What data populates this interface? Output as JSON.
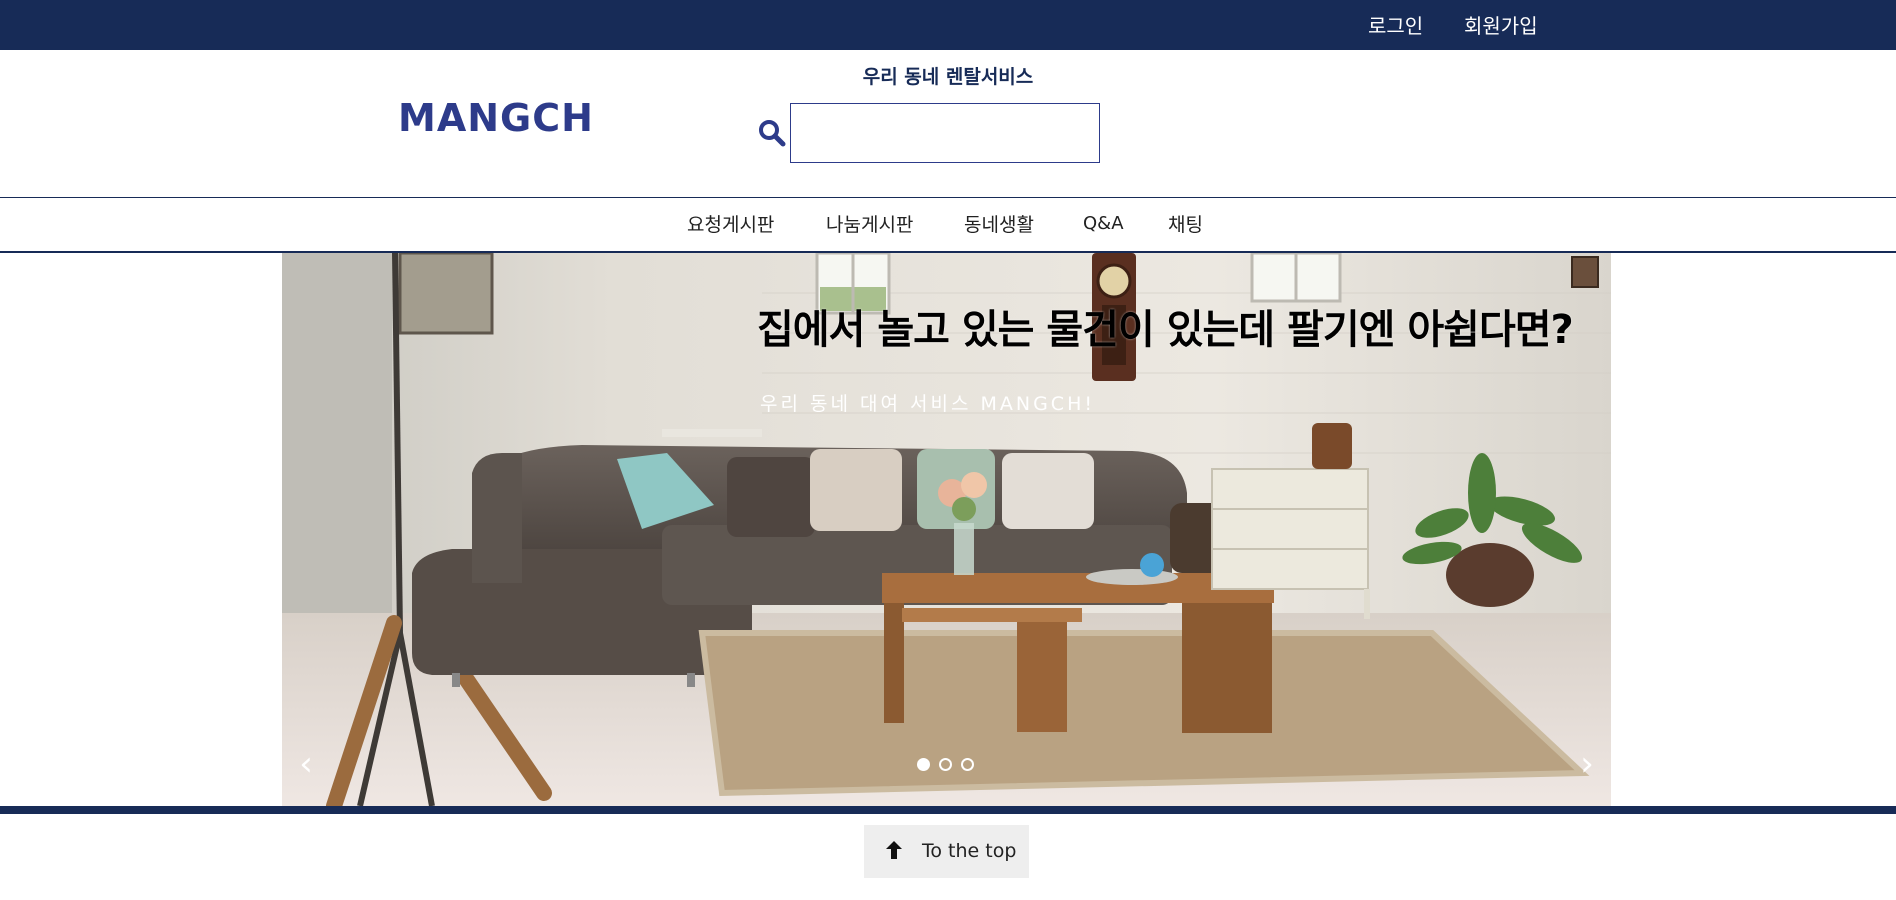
{
  "topbar": {
    "login": "로그인",
    "signup": "회원가입"
  },
  "header": {
    "logo": "MANGCH",
    "tagline": "우리 동네 렌탈서비스",
    "search": {
      "value": "",
      "placeholder": ""
    }
  },
  "nav": {
    "items": [
      "요청게시판",
      "나눔게시판",
      "동네생활",
      "Q&A",
      "채팅"
    ]
  },
  "hero": {
    "title": "집에서 놀고 있는 물건이 있는데 팔기엔 아쉽다면?",
    "subtitle": "우리 동네 대여 서비스 MANGCH!",
    "prev": "‹",
    "next": "›",
    "slide_count": 3,
    "active_slide": 1
  },
  "footer": {
    "to_top": "To the top"
  },
  "colors": {
    "primary": "#172b57",
    "logo": "#2d3b8a"
  }
}
